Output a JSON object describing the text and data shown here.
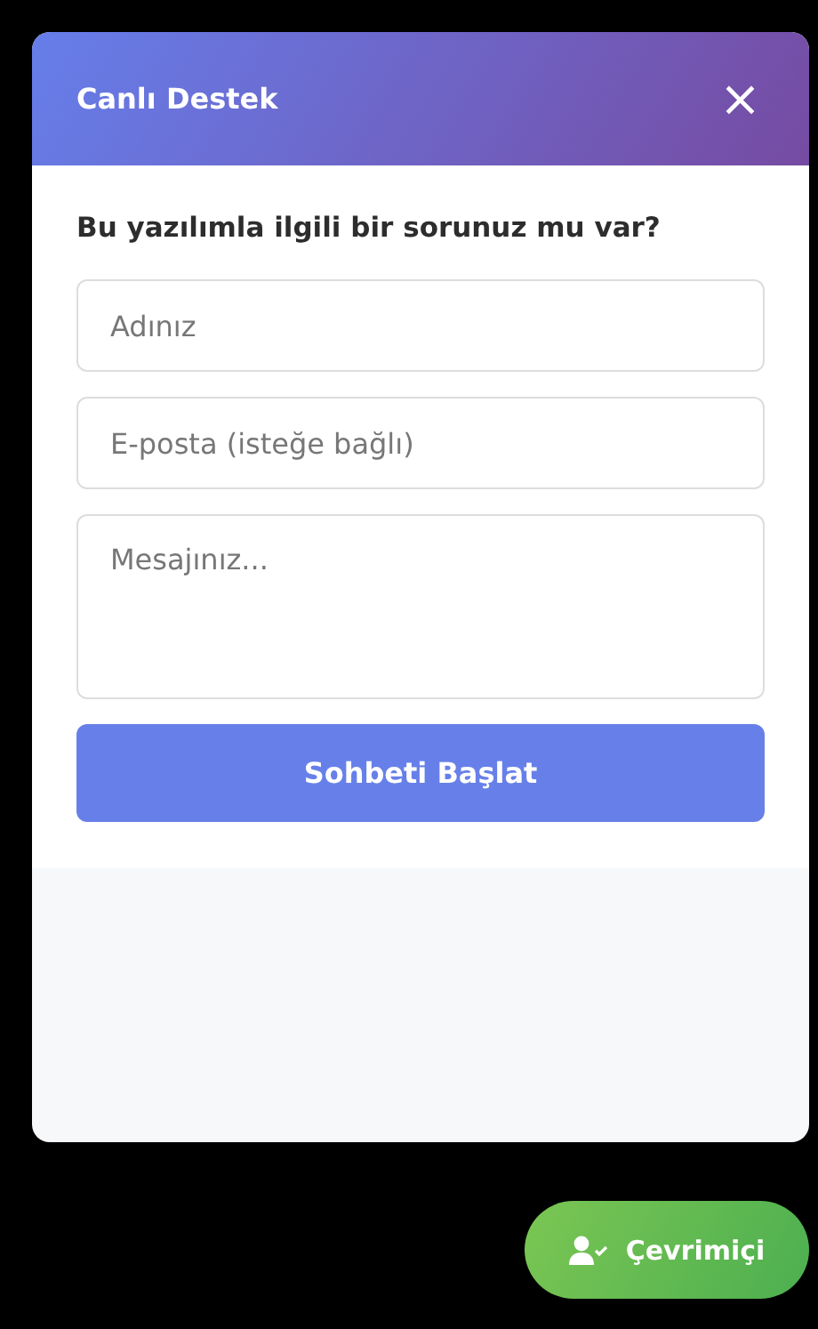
{
  "chat_panel": {
    "title": "Canlı Destek",
    "close_label": "×",
    "question": "Bu yazılımla ilgili bir sorunuz mu var?",
    "fields": [
      {
        "kind": "input",
        "placeholder": "Adınız"
      },
      {
        "kind": "input",
        "placeholder": "E-posta (isteğe bağlı)"
      },
      {
        "kind": "textarea",
        "placeholder": "Mesajınız..."
      }
    ],
    "submit": "Sohbeti Başlat"
  },
  "status_button": {
    "label": "Çevrimiçi",
    "online": true
  }
}
